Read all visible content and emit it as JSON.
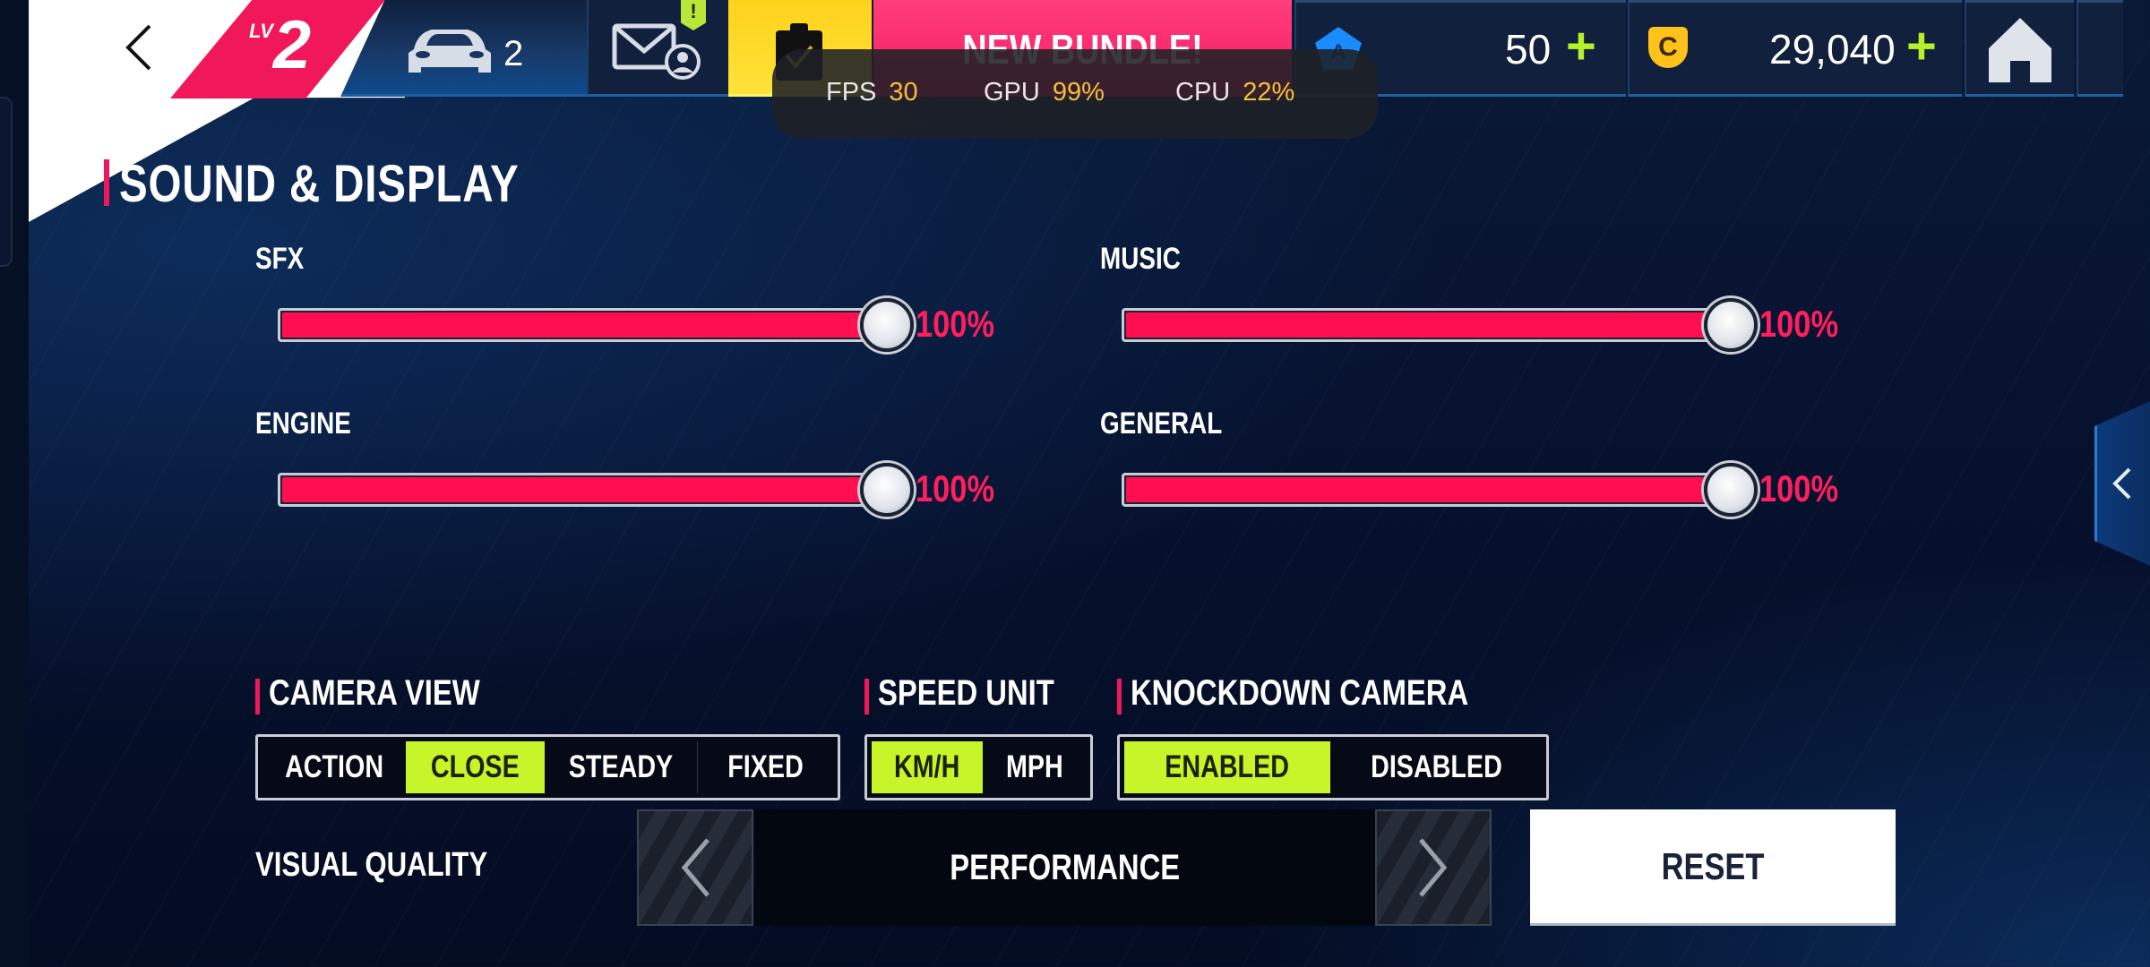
{
  "topbar": {
    "level_prefix": "LV",
    "level": "2",
    "cars_count": "2",
    "mail_alert": "!",
    "bundle_label": "NEW BUNDLE!",
    "tokens": "50",
    "credits": "29,040",
    "plus": "+",
    "coin_glyph": "C"
  },
  "perf_overlay": {
    "fps_label": "FPS",
    "fps_value": "30",
    "gpu_label": "GPU",
    "gpu_value": "99%",
    "cpu_label": "CPU",
    "cpu_value": "22%"
  },
  "page": {
    "title": "SOUND & DISPLAY"
  },
  "sliders": [
    {
      "label": "SFX",
      "value": 100,
      "display": "100%"
    },
    {
      "label": "MUSIC",
      "value": 100,
      "display": "100%"
    },
    {
      "label": "ENGINE",
      "value": 100,
      "display": "100%"
    },
    {
      "label": "GENERAL",
      "value": 100,
      "display": "100%"
    }
  ],
  "camera_view": {
    "label": "CAMERA VIEW",
    "options": [
      "ACTION",
      "CLOSE",
      "STEADY",
      "FIXED"
    ],
    "selected": "CLOSE"
  },
  "speed_unit": {
    "label": "SPEED UNIT",
    "options": [
      "KM/H",
      "MPH"
    ],
    "selected": "KM/H"
  },
  "knockdown_camera": {
    "label": "KNOCKDOWN CAMERA",
    "options": [
      "ENABLED",
      "DISABLED"
    ],
    "selected": "ENABLED"
  },
  "visual_quality": {
    "label": "VISUAL QUALITY",
    "value": "PERFORMANCE"
  },
  "reset_label": "RESET",
  "colors": {
    "accent_pink": "#f0185a",
    "slider_fill": "#ff0f4f",
    "selected_green": "#c8f52a",
    "currency_plus": "#b5f02a",
    "perf_value": "#f2c038"
  }
}
